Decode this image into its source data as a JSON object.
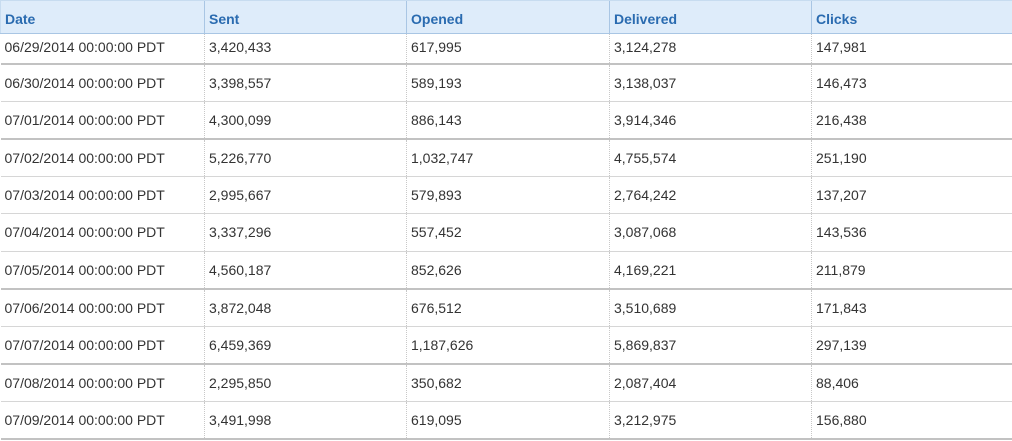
{
  "columns": [
    "Date",
    "Sent",
    "Opened",
    "Delivered",
    "Clicks"
  ],
  "rows": [
    {
      "date": "06/29/2014 00:00:00 PDT",
      "sent": "3,420,433",
      "opened": "617,995",
      "delivered": "3,124,278",
      "clicks": "147,981"
    },
    {
      "date": "06/30/2014 00:00:00 PDT",
      "sent": "3,398,557",
      "opened": "589,193",
      "delivered": "3,138,037",
      "clicks": "146,473"
    },
    {
      "date": "07/01/2014 00:00:00 PDT",
      "sent": "4,300,099",
      "opened": "886,143",
      "delivered": "3,914,346",
      "clicks": "216,438"
    },
    {
      "date": "07/02/2014 00:00:00 PDT",
      "sent": "5,226,770",
      "opened": "1,032,747",
      "delivered": "4,755,574",
      "clicks": "251,190"
    },
    {
      "date": "07/03/2014 00:00:00 PDT",
      "sent": "2,995,667",
      "opened": "579,893",
      "delivered": "2,764,242",
      "clicks": "137,207"
    },
    {
      "date": "07/04/2014 00:00:00 PDT",
      "sent": "3,337,296",
      "opened": "557,452",
      "delivered": "3,087,068",
      "clicks": "143,536"
    },
    {
      "date": "07/05/2014 00:00:00 PDT",
      "sent": "4,560,187",
      "opened": "852,626",
      "delivered": "4,169,221",
      "clicks": "211,879"
    },
    {
      "date": "07/06/2014 00:00:00 PDT",
      "sent": "3,872,048",
      "opened": "676,512",
      "delivered": "3,510,689",
      "clicks": "171,843"
    },
    {
      "date": "07/07/2014 00:00:00 PDT",
      "sent": "6,459,369",
      "opened": "1,187,626",
      "delivered": "5,869,837",
      "clicks": "297,139"
    },
    {
      "date": "07/08/2014 00:00:00 PDT",
      "sent": "2,295,850",
      "opened": "350,682",
      "delivered": "2,087,404",
      "clicks": "88,406"
    },
    {
      "date": "07/09/2014 00:00:00 PDT",
      "sent": "3,491,998",
      "opened": "619,095",
      "delivered": "3,212,975",
      "clicks": "156,880"
    }
  ],
  "colors": {
    "header_bg": "#deecfa",
    "header_text": "#2a6bb0"
  }
}
